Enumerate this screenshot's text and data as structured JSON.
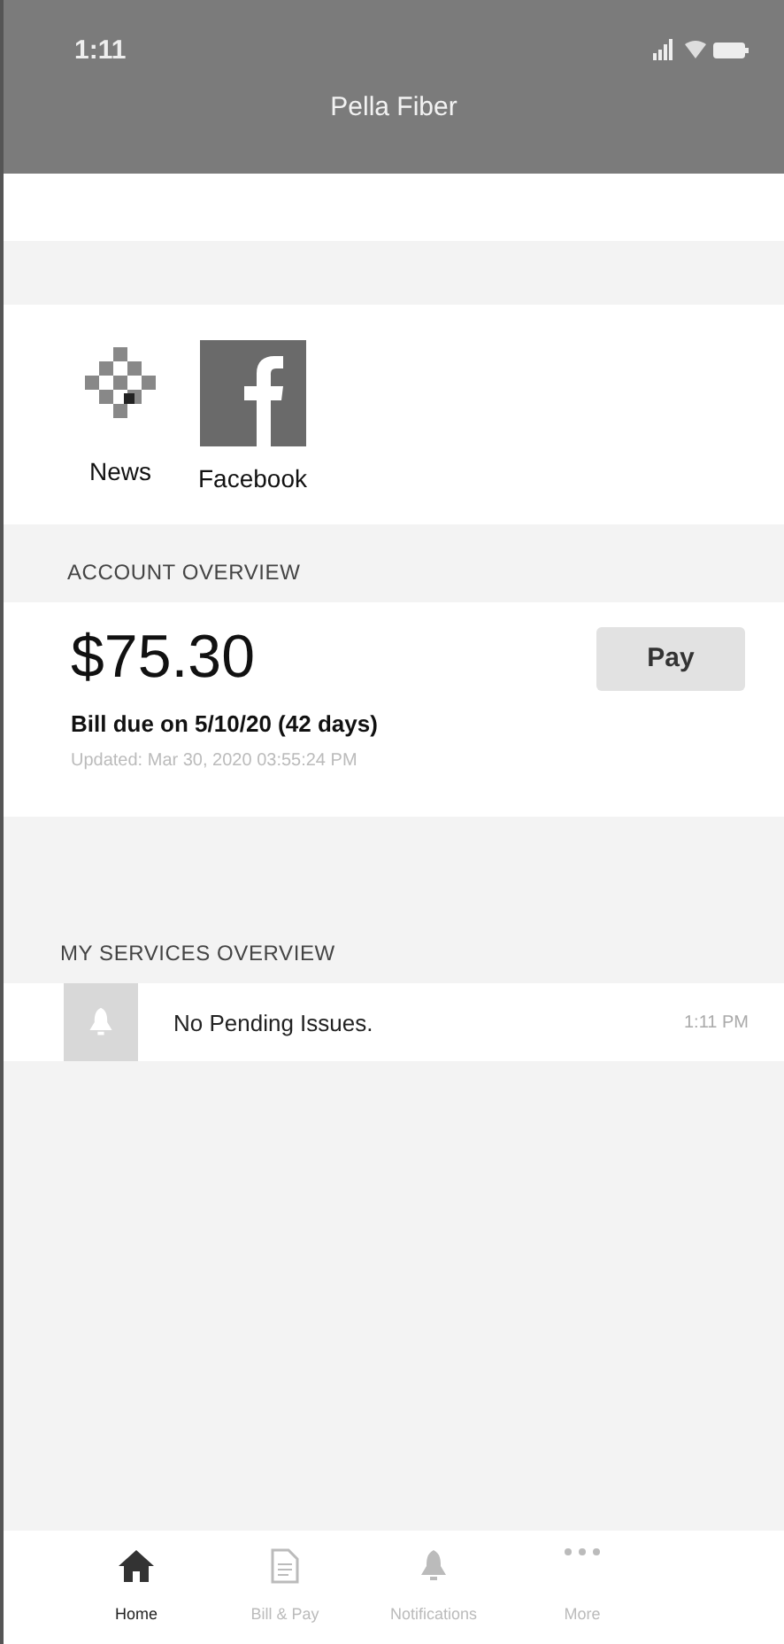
{
  "status_bar": {
    "time": "1:11"
  },
  "header": {
    "title": "Pella Fiber"
  },
  "shortcuts": [
    {
      "kind": "news",
      "label": "News"
    },
    {
      "kind": "facebook",
      "label": "Facebook"
    }
  ],
  "account_overview": {
    "heading": "ACCOUNT OVERVIEW",
    "amount": "$75.30",
    "pay_button": "Pay",
    "due": "Bill due on 5/10/20 (42 days)",
    "updated": "Updated: Mar 30, 2020 03:55:24 PM"
  },
  "services_overview": {
    "heading": "MY SERVICES OVERVIEW",
    "items": [
      {
        "text": "No Pending Issues.",
        "time": "1:11 PM"
      }
    ]
  },
  "tab_bar": [
    {
      "kind": "home",
      "label": "Home",
      "selected": true
    },
    {
      "kind": "bill",
      "label": "Bill & Pay",
      "selected": false
    },
    {
      "kind": "bell",
      "label": "Notifications",
      "selected": false
    },
    {
      "kind": "more",
      "label": "More",
      "selected": false
    }
  ]
}
